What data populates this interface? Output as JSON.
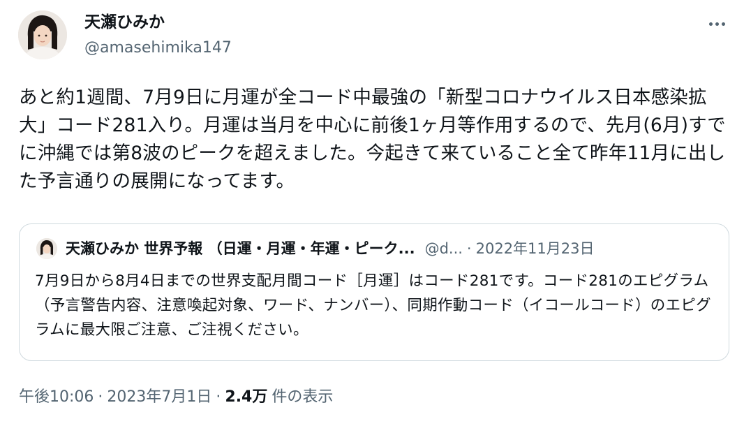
{
  "author": {
    "display_name": "天瀬ひみか",
    "handle": "@amasehimika147"
  },
  "tweet": {
    "text": "あと約1週間、7月9日に月運が全コード中最強の「新型コロナウイルス日本感染拡大」コード281入り。月運は当月を中心に前後1ヶ月等作用するので、先月(6月)すでに沖縄では第8波のピークを超えました。今起きて来ていること全て昨年11月に出した予言通りの展開になってます。"
  },
  "quote": {
    "display_name": "天瀬ひみか 世界予報 （日運・月運・年運・ピーク...",
    "handle": "@d...",
    "separator": "·",
    "date": "2022年11月23日",
    "text": "7月9日から8月4日までの世界支配月間コード［月運］はコード281です。コード281のエピグラム（予言警告内容、注意喚起対象、ワード、ナンバー）、同期作動コード（イコールコード）のエピグラムに最大限ご注意、ご注視ください。"
  },
  "meta": {
    "time": "午後10:06",
    "date": "2023年7月1日",
    "separator": "·",
    "views_count": "2.4万",
    "views_label": "件の表示"
  },
  "icons": {
    "more": "more-horizontal-icon"
  }
}
